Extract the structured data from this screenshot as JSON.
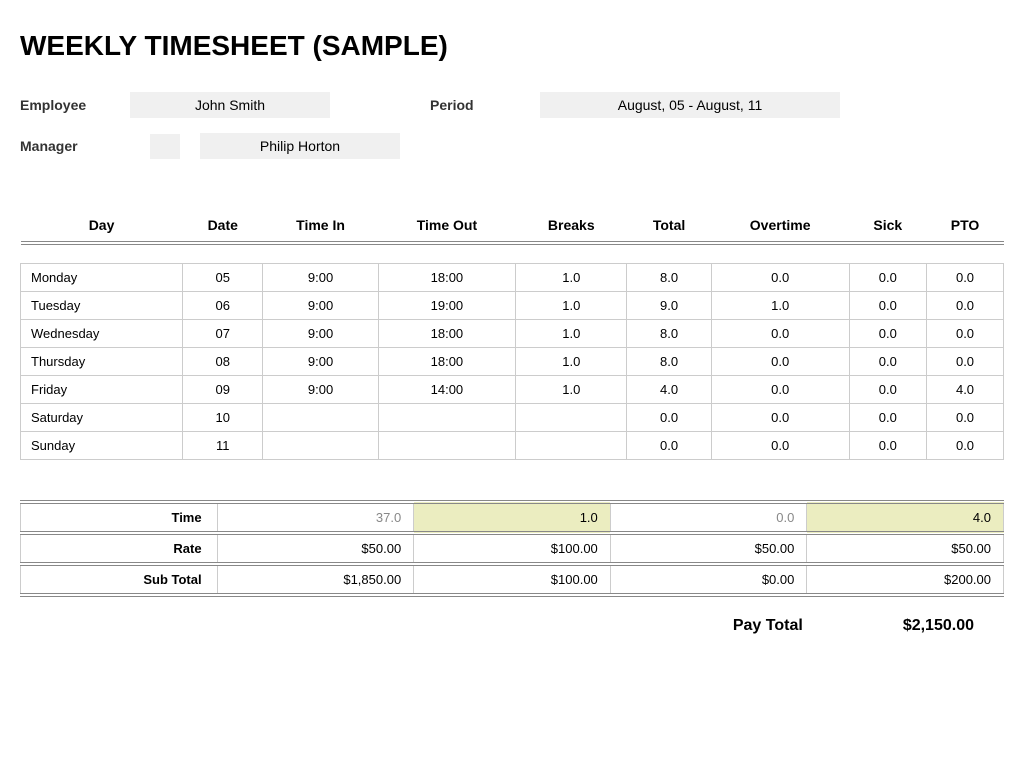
{
  "title": "WEEKLY TIMESHEET (SAMPLE)",
  "info": {
    "employee_label": "Employee",
    "employee_value": "John Smith",
    "period_label": "Period",
    "period_value": "August, 05 - August, 11",
    "manager_label": "Manager",
    "manager_value": "Philip Horton"
  },
  "columns": {
    "day": "Day",
    "date": "Date",
    "time_in": "Time In",
    "time_out": "Time Out",
    "breaks": "Breaks",
    "total": "Total",
    "overtime": "Overtime",
    "sick": "Sick",
    "pto": "PTO"
  },
  "rows": [
    {
      "day": "Monday",
      "date": "05",
      "time_in": "9:00",
      "time_out": "18:00",
      "breaks": "1.0",
      "total": "8.0",
      "overtime": "0.0",
      "sick": "0.0",
      "pto": "0.0"
    },
    {
      "day": "Tuesday",
      "date": "06",
      "time_in": "9:00",
      "time_out": "19:00",
      "breaks": "1.0",
      "total": "9.0",
      "overtime": "1.0",
      "sick": "0.0",
      "pto": "0.0"
    },
    {
      "day": "Wednesday",
      "date": "07",
      "time_in": "9:00",
      "time_out": "18:00",
      "breaks": "1.0",
      "total": "8.0",
      "overtime": "0.0",
      "sick": "0.0",
      "pto": "0.0"
    },
    {
      "day": "Thursday",
      "date": "08",
      "time_in": "9:00",
      "time_out": "18:00",
      "breaks": "1.0",
      "total": "8.0",
      "overtime": "0.0",
      "sick": "0.0",
      "pto": "0.0"
    },
    {
      "day": "Friday",
      "date": "09",
      "time_in": "9:00",
      "time_out": "14:00",
      "breaks": "1.0",
      "total": "4.0",
      "overtime": "0.0",
      "sick": "0.0",
      "pto": "4.0"
    },
    {
      "day": "Saturday",
      "date": "10",
      "time_in": "",
      "time_out": "",
      "breaks": "",
      "total": "0.0",
      "overtime": "0.0",
      "sick": "0.0",
      "pto": "0.0"
    },
    {
      "day": "Sunday",
      "date": "11",
      "time_in": "",
      "time_out": "",
      "breaks": "",
      "total": "0.0",
      "overtime": "0.0",
      "sick": "0.0",
      "pto": "0.0"
    }
  ],
  "summary": {
    "time_label": "Time",
    "time_total": "37.0",
    "time_overtime": "1.0",
    "time_sick": "0.0",
    "time_pto": "4.0",
    "rate_label": "Rate",
    "rate_total": "$50.00",
    "rate_overtime": "$100.00",
    "rate_sick": "$50.00",
    "rate_pto": "$50.00",
    "subtotal_label": "Sub Total",
    "subtotal_total": "$1,850.00",
    "subtotal_overtime": "$100.00",
    "subtotal_sick": "$0.00",
    "subtotal_pto": "$200.00"
  },
  "pay_total_label": "Pay Total",
  "pay_total_value": "$2,150.00"
}
